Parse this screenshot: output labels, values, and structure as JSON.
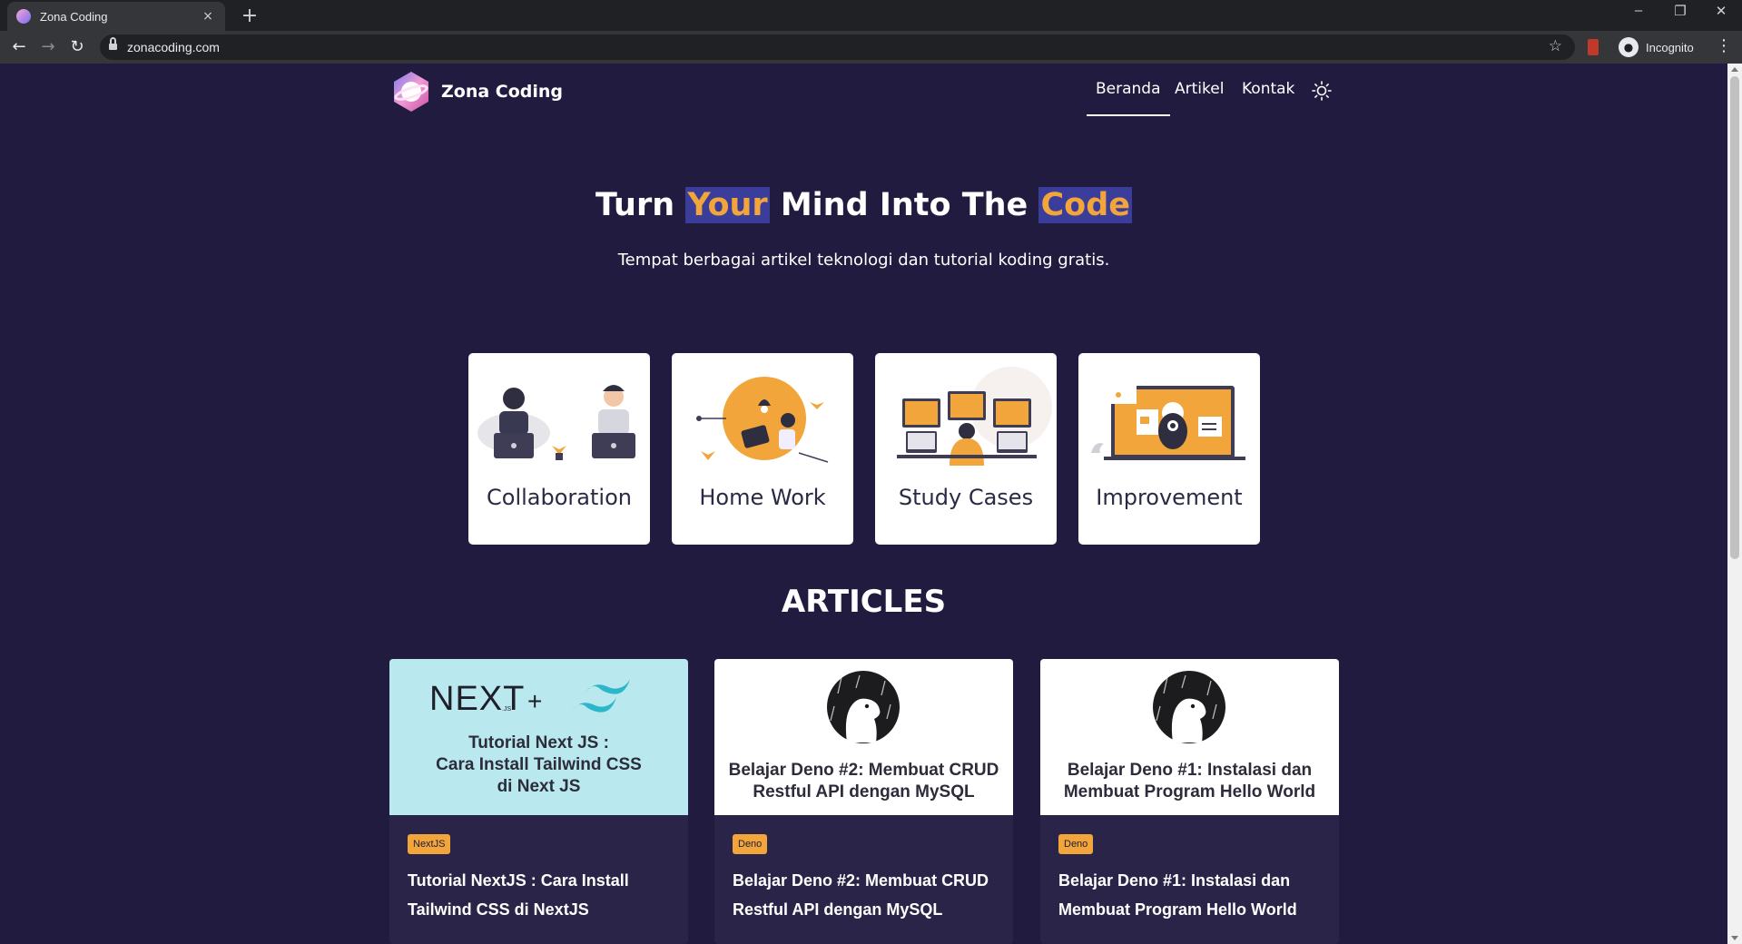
{
  "browser": {
    "tab_title": "Zona Coding",
    "tab_close": "×",
    "new_tab": "+",
    "url": "zonacoding.com",
    "profile_label": "Incognito",
    "window_controls": {
      "minimize": "–",
      "restore": "❐",
      "close": "✕"
    }
  },
  "site": {
    "brand": "Zona Coding",
    "nav": [
      {
        "label": "Beranda",
        "active": true
      },
      {
        "label": "Artikel",
        "active": false
      },
      {
        "label": "Kontak",
        "active": false
      }
    ],
    "theme_toggle_icon": "sun-icon"
  },
  "hero": {
    "title_part1": "Turn ",
    "title_hl1": "Your",
    "title_part2": " Mind Into The ",
    "title_hl2": "Code",
    "subtitle": "Tempat berbagai artikel teknologi dan tutorial koding gratis."
  },
  "features": [
    {
      "label": "Collaboration"
    },
    {
      "label": "Home Work"
    },
    {
      "label": "Study Cases"
    },
    {
      "label": "Improvement"
    }
  ],
  "articles": {
    "heading": "ARTICLES",
    "items": [
      {
        "thumb_line1": "Tutorial Next JS :",
        "thumb_line2": "Cara Install Tailwind CSS",
        "thumb_line3": "di Next JS",
        "thumb_logo_text": "NEXT",
        "thumb_logo_suffix": ".JS",
        "thumb_plus": "+",
        "tag": "NextJS",
        "title_line1": "Tutorial NextJS : Cara Install",
        "title_line2": "Tailwind CSS di NextJS"
      },
      {
        "thumb_line1": "Belajar Deno #2: Membuat CRUD",
        "thumb_line2": "Restful API dengan MySQL",
        "tag": "Deno",
        "title_line1": "Belajar Deno #2: Membuat CRUD",
        "title_line2": "Restful API dengan MySQL"
      },
      {
        "thumb_line1": "Belajar Deno #1: Instalasi dan",
        "thumb_line2": "Membuat Program Hello World",
        "tag": "Deno",
        "title_line1": "Belajar Deno #1: Instalasi dan",
        "title_line2": "Membuat Program Hello World"
      }
    ]
  },
  "colors": {
    "page_bg": "#211c3f",
    "accent": "#f2a53b",
    "highlight_bg": "#3b3d9a",
    "card_bg": "#2a2548",
    "nextjs_thumb_bg": "#b9e8ee"
  }
}
